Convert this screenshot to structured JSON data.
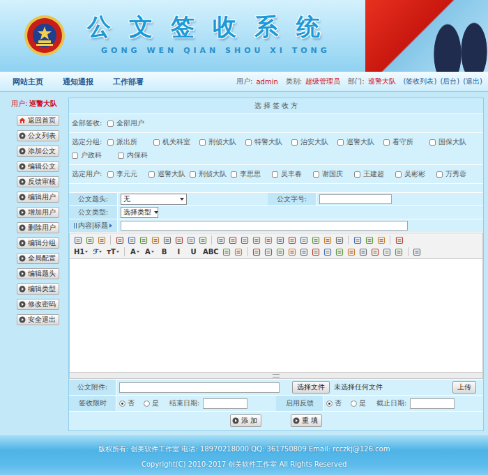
{
  "header": {
    "title": "公文签收系统",
    "subtitle": "GONG WEN QIAN SHOU XI TONG"
  },
  "nav": {
    "links": [
      "网站主页",
      "通知通报",
      "工作部署"
    ],
    "user_info": [
      {
        "label": "用户:",
        "value": "admin"
      },
      {
        "label": "类别:",
        "value": "超级管理员"
      },
      {
        "label": "部门:",
        "value": "巡警大队"
      }
    ],
    "actions": [
      "(签收列表)",
      "(后台)",
      "(退出)"
    ]
  },
  "sidebar": {
    "user_label": "用户:",
    "user_value": "巡警大队",
    "items": [
      {
        "label": "返回首页",
        "kind": "home"
      },
      {
        "label": "公文列表",
        "kind": "arrow"
      },
      {
        "label": "添加公文",
        "kind": "arrow"
      },
      {
        "label": "编辑公文",
        "kind": "arrow"
      },
      {
        "label": "反馈审核",
        "kind": "arrow"
      },
      {
        "label": "编辑用户",
        "kind": "arrow"
      },
      {
        "label": "增加用户",
        "kind": "arrow"
      },
      {
        "label": "删除用户",
        "kind": "arrow"
      },
      {
        "label": "编辑分组",
        "kind": "arrow"
      },
      {
        "label": "全局配置",
        "kind": "arrow"
      },
      {
        "label": "编辑题头",
        "kind": "arrow"
      },
      {
        "label": "编辑类型",
        "kind": "arrow"
      },
      {
        "label": "修改密码",
        "kind": "arrow"
      },
      {
        "label": "安全退出",
        "kind": "arrow"
      }
    ]
  },
  "form": {
    "title": "选 择 签 收 方",
    "all": {
      "label": "全部签收:",
      "options": [
        {
          "label": "全部用户",
          "checked": false
        }
      ]
    },
    "groups": {
      "label": "选定分组:",
      "options": [
        {
          "label": "派出所",
          "checked": false
        },
        {
          "label": "机关科室",
          "checked": false
        },
        {
          "label": "刑侦大队",
          "checked": false
        },
        {
          "label": "特警大队",
          "checked": false
        },
        {
          "label": "治安大队",
          "checked": false
        },
        {
          "label": "巡警大队",
          "checked": false
        },
        {
          "label": "看守所",
          "checked": false
        },
        {
          "label": "国保大队",
          "checked": false
        },
        {
          "label": "户政科",
          "checked": false
        },
        {
          "label": "内保科",
          "checked": false
        }
      ]
    },
    "users": {
      "label": "选定用户:",
      "options": [
        {
          "label": "李元元",
          "checked": false
        },
        {
          "label": "巡警大队",
          "checked": false
        },
        {
          "label": "刑侦大队",
          "checked": false
        },
        {
          "label": "李思思",
          "checked": false
        },
        {
          "label": "吴丰春",
          "checked": false
        },
        {
          "label": "谢国庆",
          "checked": false
        },
        {
          "label": "王建超",
          "checked": false
        },
        {
          "label": "吴彬彬",
          "checked": false
        },
        {
          "label": "万秀蓉",
          "checked": false
        }
      ]
    },
    "doc_head": {
      "label": "公文题头:",
      "value": "无"
    },
    "doc_number": {
      "label": "公文字号:",
      "value": ""
    },
    "doc_type": {
      "label": "公文类型:",
      "value": "选择类型"
    },
    "content_title": {
      "label": "内容|标题",
      "value": ""
    },
    "toolbar": [
      [
        {
          "kind": "icon"
        },
        {
          "kind": "icon"
        },
        {
          "kind": "icon"
        },
        {
          "kind": "sep"
        },
        {
          "kind": "icon"
        },
        {
          "kind": "icon"
        },
        {
          "kind": "icon"
        },
        {
          "kind": "icon"
        },
        {
          "kind": "icon"
        },
        {
          "kind": "icon"
        },
        {
          "kind": "icon"
        },
        {
          "kind": "icon"
        },
        {
          "kind": "sep"
        },
        {
          "kind": "icon"
        },
        {
          "kind": "icon"
        },
        {
          "kind": "icon"
        },
        {
          "kind": "icon"
        },
        {
          "kind": "icon"
        },
        {
          "kind": "icon"
        },
        {
          "kind": "icon"
        },
        {
          "kind": "icon"
        },
        {
          "kind": "icon"
        },
        {
          "kind": "icon"
        },
        {
          "kind": "icon"
        },
        {
          "kind": "sep"
        },
        {
          "kind": "icon"
        },
        {
          "kind": "icon"
        },
        {
          "kind": "icon"
        },
        {
          "kind": "sep"
        },
        {
          "kind": "icon"
        }
      ],
      [
        {
          "kind": "menu",
          "label": "H1"
        },
        {
          "kind": "menu",
          "label": "ℱ"
        },
        {
          "kind": "menu",
          "label": "тT"
        },
        {
          "kind": "sep"
        },
        {
          "kind": "menu",
          "label": "A"
        },
        {
          "kind": "menu",
          "label": "A"
        },
        {
          "kind": "text",
          "label": "B"
        },
        {
          "kind": "text",
          "label": "I"
        },
        {
          "kind": "text",
          "label": "U"
        },
        {
          "kind": "text",
          "label": "ABC"
        },
        {
          "kind": "icon"
        },
        {
          "kind": "icon"
        },
        {
          "kind": "sep"
        },
        {
          "kind": "icon"
        },
        {
          "kind": "icon"
        },
        {
          "kind": "icon"
        },
        {
          "kind": "icon"
        },
        {
          "kind": "icon"
        },
        {
          "kind": "icon"
        },
        {
          "kind": "icon"
        },
        {
          "kind": "icon"
        },
        {
          "kind": "icon"
        },
        {
          "kind": "icon"
        },
        {
          "kind": "icon"
        },
        {
          "kind": "icon"
        },
        {
          "kind": "icon"
        },
        {
          "kind": "sep"
        },
        {
          "kind": "icon"
        }
      ]
    ],
    "attachment": {
      "label": "公文附件:",
      "value": "",
      "button": "选择文件",
      "status": "未选择任何文件",
      "upload": "上传"
    },
    "time_limit": {
      "label": "签收限时",
      "options": [
        {
          "label": "否",
          "selected": true
        },
        {
          "label": "是",
          "selected": false
        }
      ],
      "date_label": "结束日期:",
      "date_value": ""
    },
    "feedback": {
      "label": "启用反馈",
      "options": [
        {
          "label": "否",
          "selected": true
        },
        {
          "label": "是",
          "selected": false
        }
      ],
      "date_label": "截止日期:",
      "date_value": ""
    },
    "buttons": [
      "添 加",
      "重 填"
    ]
  },
  "footer": {
    "lines": [
      "版权所有: 创美软件工作室 电话: 18970218000 QQ: 361750809 Email: rcczkj@126.com",
      "Copyright(C) 2010-2017 创美软件工作室 All Rights Reserved"
    ]
  }
}
